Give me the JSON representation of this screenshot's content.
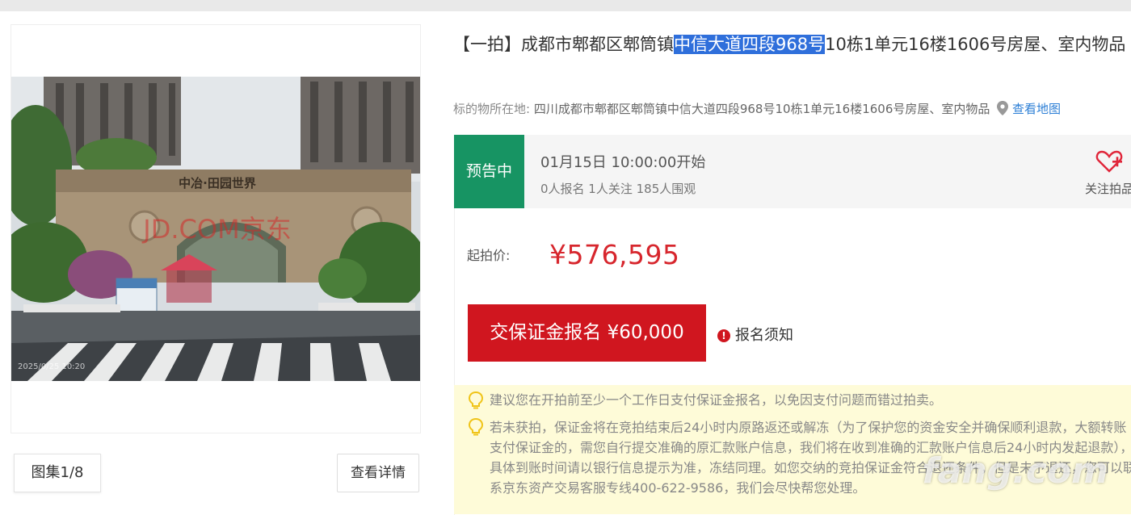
{
  "gallery": {
    "counter": "图集1/8",
    "details_button": "查看详情",
    "photo_caption": "中冶·田园世界",
    "photo_watermark": "JD.COM京东",
    "photo_timestamp": "2025/0/25 10:20"
  },
  "listing": {
    "title_prefix": "【一拍】成都市郫都区郫筒镇",
    "title_highlight": "中信大道四段968号",
    "title_suffix": "10栋1单元16楼1606号房屋、室内物品",
    "location_label": "标的物所在地:",
    "location_value": "四川成都市郫都区郫筒镇中信大道四段968号10栋1单元16楼1606号房屋、室内物品",
    "map_link": "查看地图"
  },
  "status": {
    "badge": "预告中",
    "start_time": "01月15日 10:00:00开始",
    "stats": "0人报名  1人关注  185人围观",
    "follow_label": "关注拍品"
  },
  "pricing": {
    "start_label": "起拍价:",
    "start_price": "¥576,595",
    "deposit_button": "交保证金报名 ¥60,000",
    "notice_link": "报名须知"
  },
  "tips": [
    "建议您在开拍前至少一个工作日支付保证金报名，以免因支付问题而错过拍卖。",
    "若未获拍，保证金将在竞拍结束后24小时内原路返还或解冻（为了保护您的资金安全并确保顺利退款，大额转账支付保证金的，需您自行提交准确的原汇款账户信息，我们将在收到准确的汇款账户信息后24小时内发起退款），具体到账时间请以银行信息提示为准，冻结同理。如您交纳的竞拍保证金符合退还条件，但是未予退还，您可以联系京东资产交易客服专线400-622-9586，我们会尽快帮您处理。"
  ],
  "site_watermark": "fang.com",
  "colors": {
    "accent_red": "#d0161f",
    "status_green": "#179463",
    "link_blue": "#2d7fd6",
    "tip_bg": "#fefbd8"
  }
}
